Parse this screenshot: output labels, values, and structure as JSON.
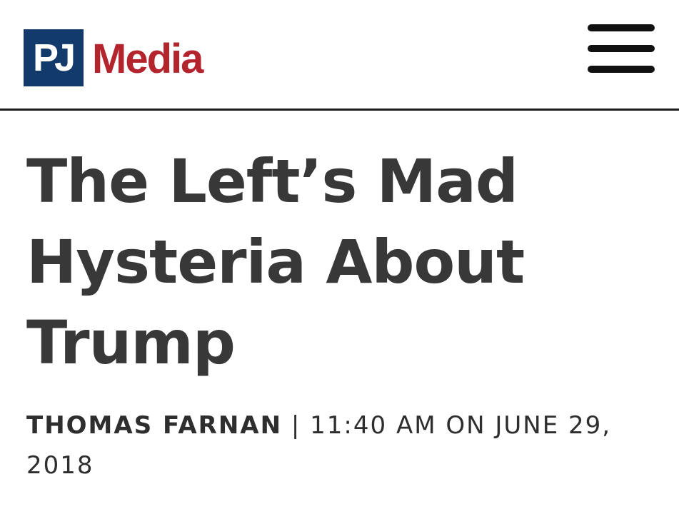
{
  "header": {
    "logo_mark": "PJ",
    "logo_name": "Media",
    "menu_icon": "hamburger-menu-icon"
  },
  "colors": {
    "logo_box": "#123a6b",
    "logo_text": "#b3242c",
    "headline": "#383838",
    "divider": "#1a1a1a"
  },
  "article": {
    "title": "The Left’s Mad Hysteria About Trump",
    "author": "THOMAS FARNAN",
    "separator": " | ",
    "date": "11:40 AM ON JUNE 29, 2018"
  }
}
